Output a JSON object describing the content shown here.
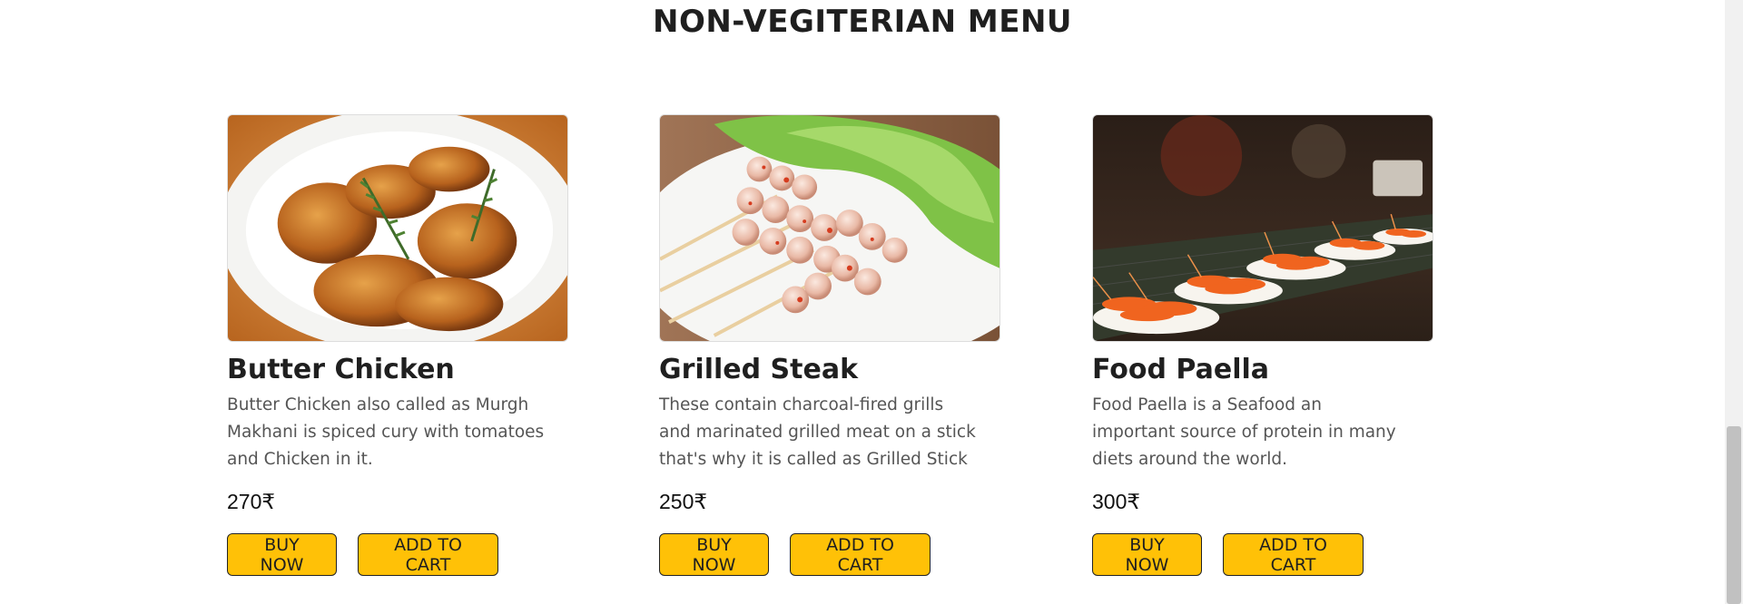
{
  "page": {
    "title": "NON-VEGITERIAN MENU"
  },
  "items": [
    {
      "name": "Butter Chicken",
      "description": "Butter Chicken also called as Murgh Makhani is spiced cury with tomatoes and Chicken in it.",
      "price": "270₹",
      "buy_label": "BUY NOW",
      "cart_label": "ADD TO CART",
      "image_icon": "roast-chicken-plate-image"
    },
    {
      "name": "Grilled Steak",
      "description": "These contain charcoal-fired grills and marinated grilled meat on a stick that's why it is called as Grilled Stick",
      "price": "250₹",
      "buy_label": "BUY NOW",
      "cart_label": "ADD TO CART",
      "image_icon": "meatball-skewers-image"
    },
    {
      "name": "Food Paella",
      "description": "Food Paella is a Seafood an important source of protein in many diets around the world.",
      "price": "300₹",
      "buy_label": "BUY NOW",
      "cart_label": "ADD TO CART",
      "image_icon": "grilled-shrimp-stall-image"
    }
  ],
  "colors": {
    "button_bg": "#ffc107",
    "title": "#1f1f1f",
    "description": "#555555"
  }
}
